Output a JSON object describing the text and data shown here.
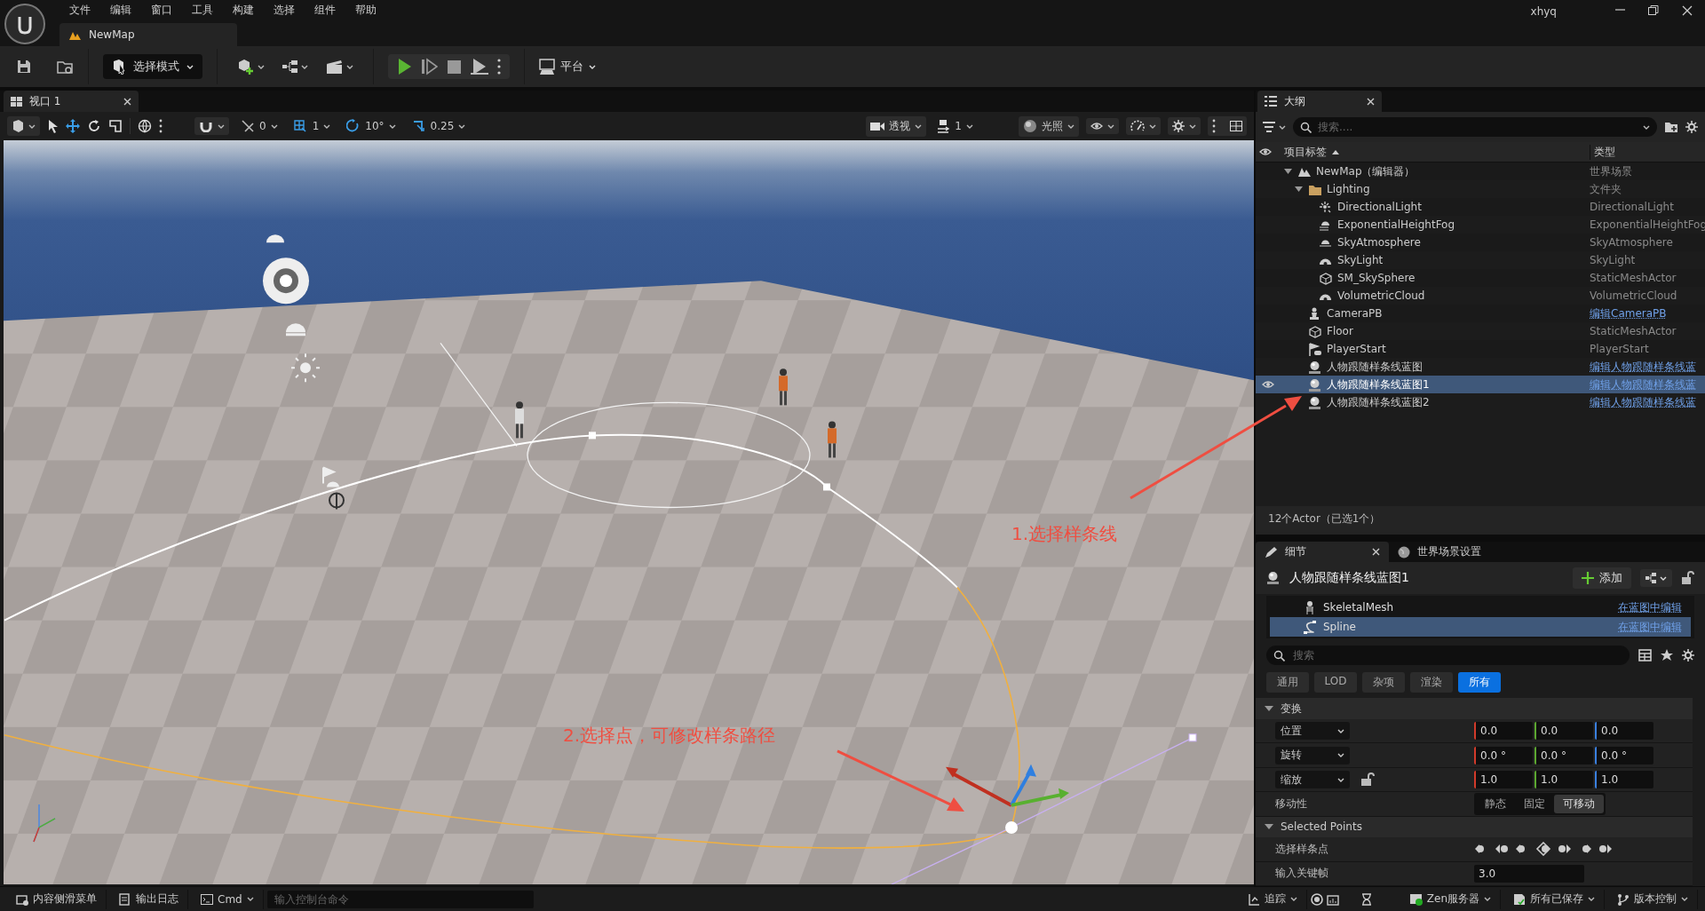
{
  "menu": [
    "文件",
    "编辑",
    "窗口",
    "工具",
    "构建",
    "选择",
    "组件",
    "帮助"
  ],
  "user": "xhyq",
  "document_tab": {
    "label": "NewMap"
  },
  "toolbar": {
    "mode": "选择模式",
    "platform": "平台"
  },
  "viewport": {
    "tab": "视口 1",
    "snaps": [
      {
        "kind": "surface",
        "value": "0"
      },
      {
        "kind": "grid",
        "value": "1"
      },
      {
        "kind": "rotate",
        "value": "10°"
      },
      {
        "kind": "scale",
        "value": "0.25"
      }
    ],
    "view_mode": "透视",
    "camera_speed": "1",
    "lighting": "光照",
    "annotations": [
      {
        "text": "1.选择样条线"
      },
      {
        "text": "2.选择点，可修改样条路径"
      }
    ]
  },
  "outliner": {
    "title": "大纲",
    "search_placeholder": "搜索....",
    "columns": [
      "项目标签",
      "类型"
    ],
    "items": [
      {
        "label": "NewMap（编辑器）",
        "type": "世界场景",
        "kind": "world",
        "link": false,
        "selected": false,
        "expanded": true,
        "children": [
          {
            "label": "Lighting",
            "type": "文件夹",
            "kind": "folder",
            "link": false,
            "selected": false,
            "expanded": true,
            "children": [
              {
                "label": "DirectionalLight",
                "type": "DirectionalLight",
                "kind": "light",
                "link": false,
                "selected": false
              },
              {
                "label": "ExponentialHeightFog",
                "type": "ExponentialHeightFog",
                "kind": "fog",
                "link": false,
                "selected": false
              },
              {
                "label": "SkyAtmosphere",
                "type": "SkyAtmosphere",
                "kind": "atmosphere",
                "link": false,
                "selected": false
              },
              {
                "label": "SkyLight",
                "type": "SkyLight",
                "kind": "dome",
                "link": false,
                "selected": false
              },
              {
                "label": "SM_SkySphere",
                "type": "StaticMeshActor",
                "kind": "mesh",
                "link": false,
                "selected": false
              },
              {
                "label": "VolumetricCloud",
                "type": "VolumetricCloud",
                "kind": "dome",
                "link": false,
                "selected": false
              }
            ]
          },
          {
            "label": "CameraPB",
            "type": "编辑CameraPB",
            "kind": "pawn",
            "link": true,
            "selected": false
          },
          {
            "label": "Floor",
            "type": "StaticMeshActor",
            "kind": "mesh",
            "link": false,
            "selected": false
          },
          {
            "label": "PlayerStart",
            "type": "PlayerStart",
            "kind": "flag",
            "link": false,
            "selected": false
          },
          {
            "label": "人物跟随样条线蓝图",
            "type": "编辑人物跟随样条线蓝",
            "kind": "blueprint",
            "link": true,
            "selected": false
          },
          {
            "label": "人物跟随样条线蓝图1",
            "type": "编辑人物跟随样条线蓝",
            "kind": "blueprint",
            "link": true,
            "selected": true
          },
          {
            "label": "人物跟随样条线蓝图2",
            "type": "编辑人物跟随样条线蓝",
            "kind": "blueprint",
            "link": true,
            "selected": false
          }
        ]
      }
    ],
    "footer": "12个Actor（已选1个）"
  },
  "details": {
    "tabs": [
      {
        "label": "细节",
        "selected": true
      },
      {
        "label": "世界场景设置",
        "selected": false
      }
    ],
    "actor": "人物跟随样条线蓝图1",
    "add": "添加",
    "components": [
      {
        "name": "SkeletalMesh",
        "kind": "skeleton",
        "action": "在蓝图中编辑",
        "selected": false
      },
      {
        "name": "Spline",
        "kind": "spline",
        "action": "在蓝图中编辑",
        "selected": true
      }
    ],
    "search_placeholder": "搜索",
    "filters": [
      {
        "label": "通用",
        "selected": false
      },
      {
        "label": "LOD",
        "selected": false
      },
      {
        "label": "杂项",
        "selected": false
      },
      {
        "label": "渲染",
        "selected": false
      },
      {
        "label": "所有",
        "selected": true
      }
    ],
    "sections": [
      {
        "title": "变换",
        "expanded": true,
        "rows": [
          {
            "kind": "vector",
            "label": "位置",
            "lock": false,
            "values": [
              "0.0",
              "0.0",
              "0.0"
            ]
          },
          {
            "kind": "vector",
            "label": "旋转",
            "lock": false,
            "values": [
              "0.0 °",
              "0.0 °",
              "0.0 °"
            ]
          },
          {
            "kind": "vector",
            "label": "缩放",
            "lock": true,
            "values": [
              "1.0",
              "1.0",
              "1.0"
            ]
          },
          {
            "kind": "segmented",
            "label": "移动性",
            "options": [
              {
                "label": "静态",
                "selected": false
              },
              {
                "label": "固定",
                "selected": false
              },
              {
                "label": "可移动",
                "selected": true
              }
            ]
          }
        ]
      },
      {
        "title": "Selected Points",
        "expanded": true,
        "rows": [
          {
            "kind": "point-buttons",
            "label": "选择样条点"
          },
          {
            "kind": "number",
            "label": "输入关键帧",
            "value": "3.0"
          }
        ]
      }
    ]
  },
  "status_bar": {
    "left": [
      {
        "kind": "drawer",
        "label": "内容侧滑菜单"
      },
      {
        "kind": "log",
        "label": "输出日志"
      },
      {
        "kind": "cmd",
        "label": "Cmd"
      }
    ],
    "console_placeholder": "输入控制台命令",
    "right": [
      {
        "kind": "trace",
        "label": "追踪"
      },
      {
        "kind": "zen",
        "label": "Zen服务器"
      },
      {
        "kind": "save",
        "label": "所有已保存"
      },
      {
        "kind": "source",
        "label": "版本控制"
      }
    ]
  }
}
